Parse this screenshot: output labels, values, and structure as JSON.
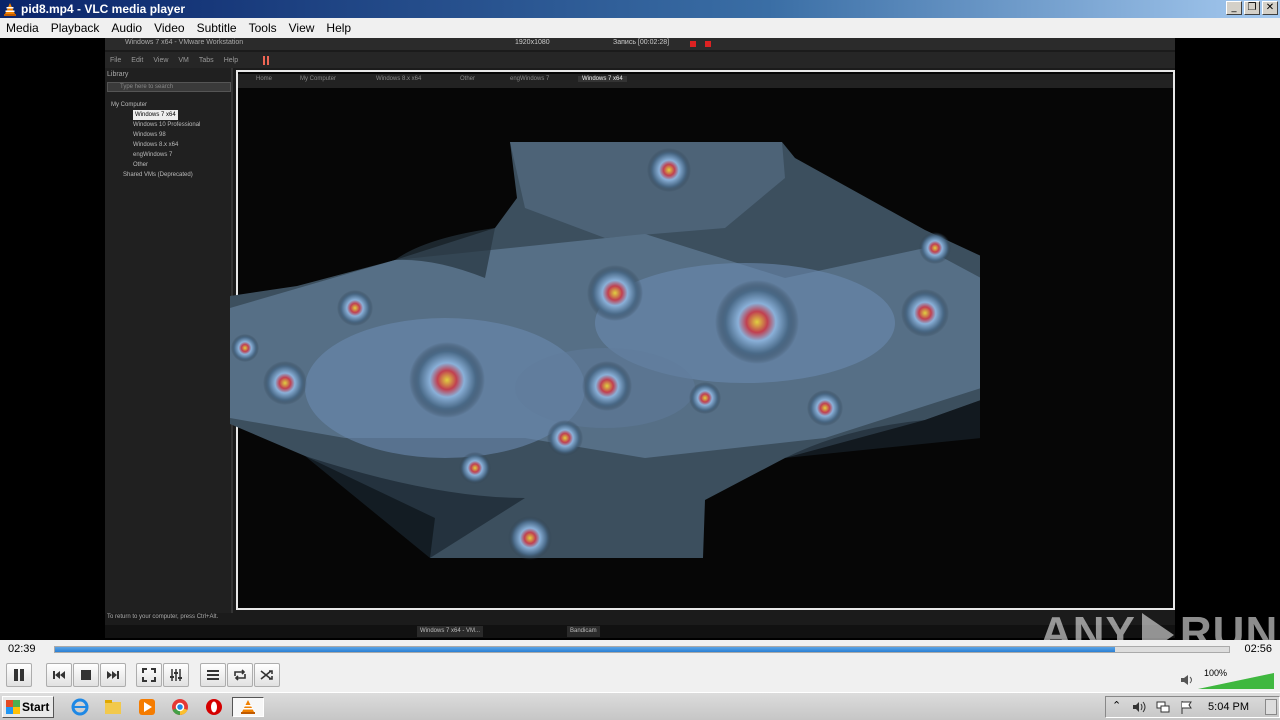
{
  "window": {
    "title": "pid8.mp4 - VLC media player",
    "buttons": [
      "minimize",
      "restore",
      "close"
    ]
  },
  "menu": [
    "Media",
    "Playback",
    "Audio",
    "Video",
    "Subtitle",
    "Tools",
    "View",
    "Help"
  ],
  "video": {
    "vmware_title": "Windows 7 x64 - VMware Workstation",
    "resolution": "1920x1080",
    "recording": "Запись [00:02:28]",
    "menu": [
      "File",
      "Edit",
      "View",
      "VM",
      "Tabs",
      "Help"
    ],
    "library_label": "Library",
    "search_placeholder": "Type here to search",
    "tree": [
      "My Computer",
      "Windows 7 x64",
      "Windows 10 Professional",
      "Windows 98",
      "Windows 8.x x64",
      "engWindows 7",
      "Other",
      "Shared VMs (Deprecated)"
    ],
    "tabs": [
      "Home",
      "My Computer",
      "Windows 8.x x64",
      "Other",
      "engWindows 7",
      "Windows 7 x64"
    ],
    "status": "To return to your computer, press Ctrl+Alt.",
    "taskbar_items": [
      "Windows 7 x64 - VM...",
      "Bandicam"
    ]
  },
  "watermark": {
    "text_left": "ANY",
    "text_right": "RUN"
  },
  "playback": {
    "current_time": "02:39",
    "total_time": "02:56",
    "progress": 0.903,
    "volume_percent": "100%"
  },
  "controls": [
    "pause-button",
    "previous-button",
    "stop-button",
    "next-button",
    "fullscreen-button",
    "extended-settings-button",
    "playlist-button",
    "loop-button",
    "shuffle-button"
  ],
  "taskbar": {
    "start_label": "Start",
    "clock": "5:04 PM"
  }
}
